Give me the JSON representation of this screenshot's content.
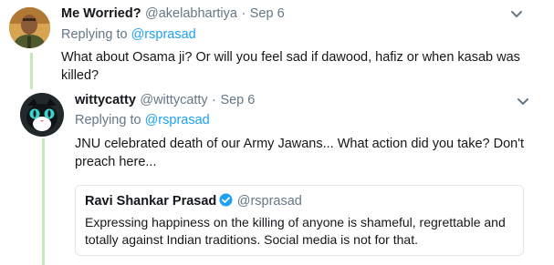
{
  "tweet1": {
    "display_name": "Me Worried?",
    "handle": "@akelabhartiya",
    "dot": "·",
    "date": "Sep 6",
    "replying_prefix": "Replying to ",
    "replying_handle": "@rsprasad",
    "text_line1": "What about Osama ji? Or will you feel sad if dawood, hafiz or when kasab was",
    "text_line2": "killed?"
  },
  "tweet2": {
    "display_name": "wittycatty",
    "handle": "@wittycatty",
    "dot": "·",
    "date": "Sep 6",
    "replying_prefix": "Replying to ",
    "replying_handle": "@rsprasad",
    "text_line1": "JNU celebrated death of our Army Jawans... What action did you take? Don't",
    "text_line2": "preach here..."
  },
  "quoted": {
    "display_name": "Ravi Shankar Prasad",
    "handle": "@rsprasad",
    "text_line1": "Expressing happiness on the killing of anyone is shameful, regrettable and",
    "text_line2": "totally against Indian traditions. Social media is not for that."
  },
  "colors": {
    "link": "#1da1f2",
    "thread_line": "#c4e9b8",
    "secondary_text": "#657786",
    "verified_badge": "#1da1f2"
  },
  "icons": {
    "tweet_menu": "chevron-down-icon",
    "verified": "verified-badge-icon"
  }
}
